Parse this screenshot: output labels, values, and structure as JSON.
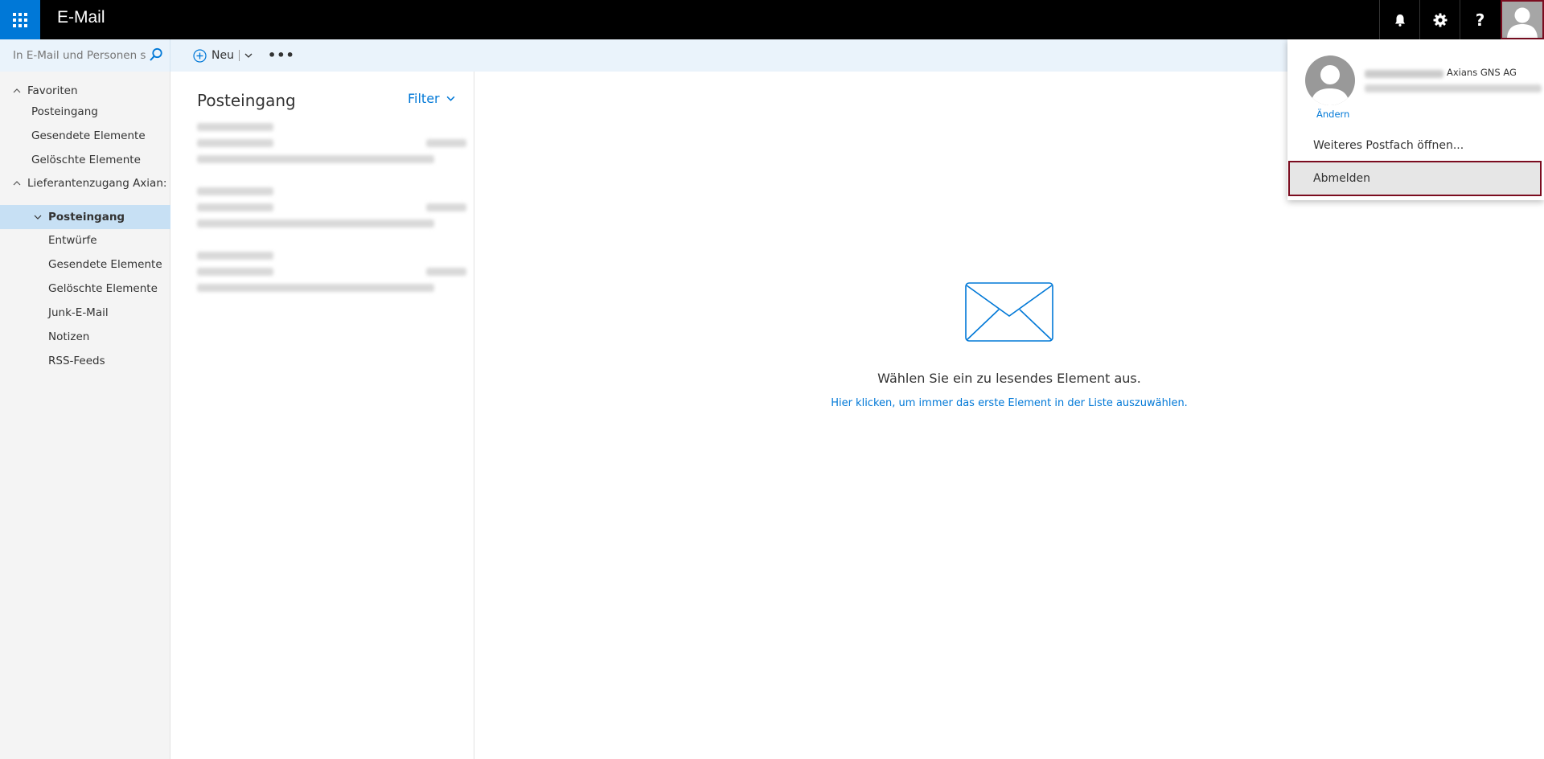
{
  "header": {
    "app_title": "E-Mail",
    "icons": [
      "app-launcher-icon",
      "bell-icon",
      "gear-icon",
      "help-icon",
      "avatar-icon"
    ],
    "help_glyph": "?"
  },
  "search": {
    "placeholder": "In E-Mail und Personen s..."
  },
  "toolbar": {
    "new_label": "Neu",
    "more_label": "•••"
  },
  "sidebar": {
    "favorites": {
      "label": "Favoriten",
      "items": [
        "Posteingang",
        "Gesendete Elemente",
        "Gelöschte Elemente"
      ]
    },
    "mailbox": {
      "label": "Lieferantenzugang Axian:",
      "items": [
        {
          "label": "Posteingang",
          "selected": true
        },
        {
          "label": "Entwürfe"
        },
        {
          "label": "Gesendete Elemente"
        },
        {
          "label": "Gelöschte Elemente"
        },
        {
          "label": "Junk-E-Mail"
        },
        {
          "label": "Notizen"
        },
        {
          "label": "RSS-Feeds"
        }
      ]
    }
  },
  "message_list": {
    "title": "Posteingang",
    "filter_label": "Filter",
    "message_count": 3
  },
  "reading_pane": {
    "empty_text": "Wählen Sie ein zu lesendes Element aus.",
    "link_text": "Hier klicken, um immer das erste Element in der Liste auszuwählen."
  },
  "account_menu": {
    "org": "Axians GNS AG",
    "change_label": "Ändern",
    "open_mailbox_label": "Weiteres Postfach öffnen...",
    "logout_label": "Abmelden"
  },
  "colors": {
    "accent": "#0078d7",
    "topbar": "#000000",
    "selected_folder": "#c7e0f4",
    "highlight_border": "#7b0c1f"
  }
}
